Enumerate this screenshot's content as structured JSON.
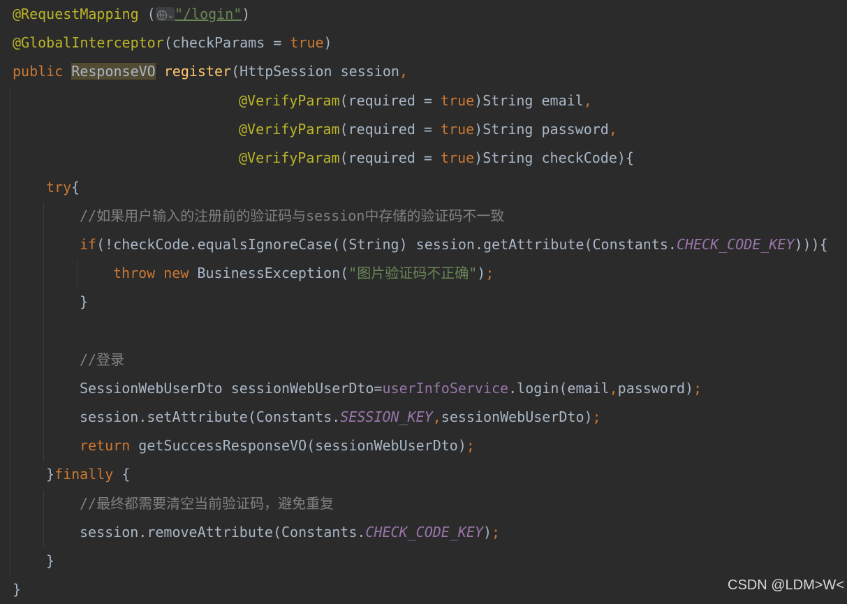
{
  "code": {
    "l1": {
      "anno": "@RequestMapping",
      "open": " (",
      "path": "\"/login\"",
      "close": ")"
    },
    "l2": {
      "anno": "@GlobalInterceptor",
      "open": "(checkParams = ",
      "value": "true",
      "close": ")"
    },
    "l3": {
      "kw": "public",
      "type": "ResponseVO",
      "method": "register",
      "params": "(HttpSession session",
      "comma": ","
    },
    "l4": {
      "anno": "@VerifyParam",
      "open": "(required = ",
      "value": "true",
      "rest": ")String email",
      "comma": ","
    },
    "l5": {
      "anno": "@VerifyParam",
      "open": "(required = ",
      "value": "true",
      "rest": ")String password",
      "comma": ","
    },
    "l6": {
      "anno": "@VerifyParam",
      "open": "(required = ",
      "value": "true",
      "rest": ")String checkCode){"
    },
    "l7": {
      "kw": "try",
      "rest": "{"
    },
    "l8": {
      "comment": "//如果用户输入的注册前的验证码与session中存储的验证码不一致"
    },
    "l9": {
      "kw": "if",
      "rest": "(!checkCode.equalsIgnoreCase((String) session.getAttribute(Constants.",
      "const": "CHECK_CODE_KEY",
      "close": "))){"
    },
    "l10": {
      "kw1": "throw",
      "kw2": "new",
      "rest": " BusinessException(",
      "str": "\"图片验证码不正确\"",
      "close": ")",
      "semi": ";"
    },
    "l11": {
      "text": "}"
    },
    "l13": {
      "comment": "//登录"
    },
    "l14": {
      "rest": "SessionWebUserDto sessionWebUserDto=",
      "field": "userInfoService",
      "call": ".login(email",
      "comma": ",",
      "tail": "password)",
      "semi": ";"
    },
    "l15": {
      "rest": "session.setAttribute(Constants.",
      "const": "SESSION_KEY",
      "comma": ",",
      "tail": "sessionWebUserDto)",
      "semi": ";"
    },
    "l16": {
      "kw": "return",
      "rest": " getSuccessResponseVO(sessionWebUserDto)",
      "semi": ";"
    },
    "l17": {
      "brace": "}",
      "kw": "finally",
      "rest": " {"
    },
    "l18": {
      "comment": "//最终都需要清空当前验证码，避免重复"
    },
    "l19": {
      "rest": "session.removeAttribute(Constants.",
      "const": "CHECK_CODE_KEY",
      "close": ")",
      "semi": ";"
    },
    "l20": {
      "text": "}"
    },
    "l21": {
      "text": "}"
    }
  },
  "watermark": "CSDN @LDM>W<",
  "colors": {
    "background": "#2b2b2b",
    "annotation": "#bbb529",
    "keyword": "#cc7832",
    "string": "#6a8759",
    "comment": "#808080",
    "constant": "#9876aa",
    "method": "#ffc66d",
    "text": "#a9b7c6"
  }
}
